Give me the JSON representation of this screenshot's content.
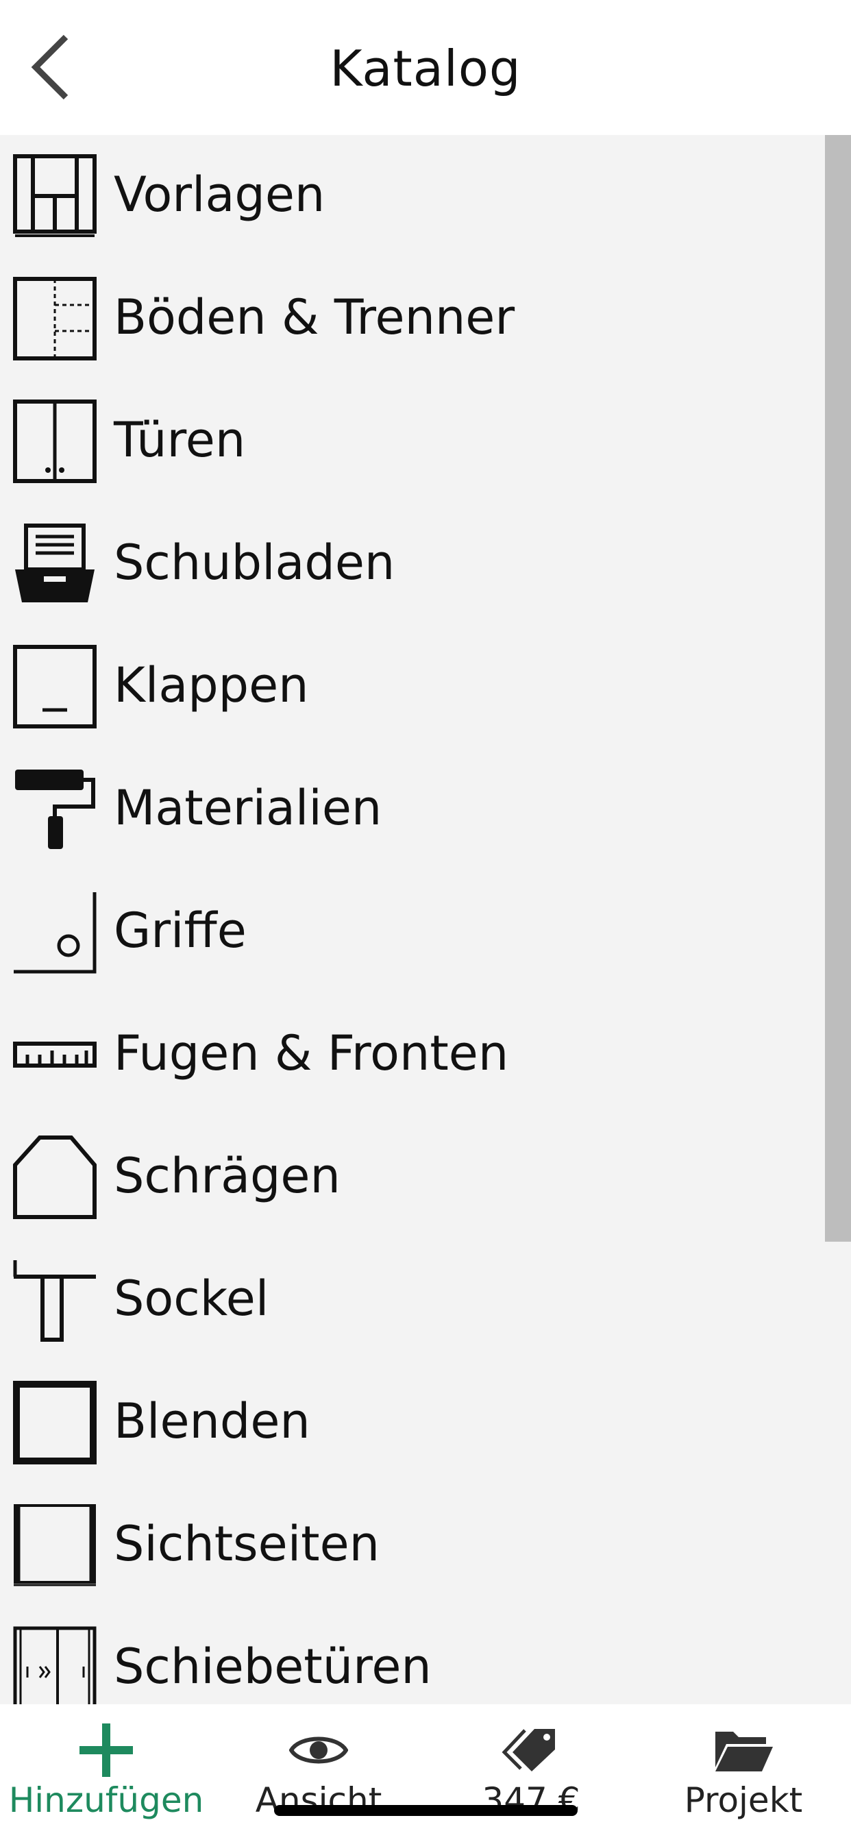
{
  "header": {
    "title": "Katalog",
    "back_icon": "chevron-left-icon"
  },
  "catalog": {
    "items": [
      {
        "label": "Vorlagen",
        "icon": "templates-icon"
      },
      {
        "label": "Böden & Trenner",
        "icon": "shelves-dividers-icon"
      },
      {
        "label": "Türen",
        "icon": "doors-icon"
      },
      {
        "label": "Schubladen",
        "icon": "drawers-icon"
      },
      {
        "label": "Klappen",
        "icon": "flaps-icon"
      },
      {
        "label": "Materialien",
        "icon": "paint-roller-icon"
      },
      {
        "label": "Griffe",
        "icon": "handles-icon"
      },
      {
        "label": "Fugen & Fronten",
        "icon": "ruler-icon"
      },
      {
        "label": "Schrägen",
        "icon": "slope-icon"
      },
      {
        "label": "Sockel",
        "icon": "plinth-icon"
      },
      {
        "label": "Blenden",
        "icon": "panels-icon"
      },
      {
        "label": "Sichtseiten",
        "icon": "visible-sides-icon"
      },
      {
        "label": "Schiebetüren",
        "icon": "sliding-doors-icon"
      }
    ]
  },
  "tabbar": {
    "tabs": [
      {
        "label": "Hinzufügen",
        "icon": "plus-icon",
        "active": true
      },
      {
        "label": "Ansicht",
        "icon": "eye-icon",
        "active": false
      },
      {
        "label": "347 €",
        "icon": "price-tag-icon",
        "active": false
      },
      {
        "label": "Projekt",
        "icon": "folder-icon",
        "active": false
      }
    ]
  },
  "colors": {
    "accent": "#1e8a5e",
    "list_background": "#f3f3f3",
    "scrollbar": "#bdbdbd",
    "text": "#111111"
  }
}
